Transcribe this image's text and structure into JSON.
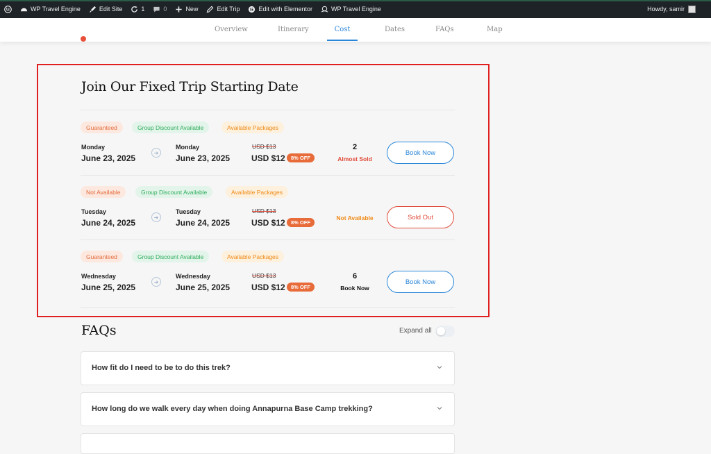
{
  "adminbar": {
    "site_name": "WP Travel Engine",
    "edit_site": "Edit Site",
    "updates_count": "1",
    "comments_count": "0",
    "new_label": "New",
    "edit_trip": "Edit Trip",
    "elementor": "Edit with Elementor",
    "plugin_label": "WP Travel Engine",
    "howdy": "Howdy, samir"
  },
  "tabs": [
    {
      "label": "Overview"
    },
    {
      "label": "Itinerary"
    },
    {
      "label": "Cost",
      "active": true
    },
    {
      "label": "Dates"
    },
    {
      "label": "FAQs"
    },
    {
      "label": "Map"
    }
  ],
  "dates_section": {
    "title": "Join Our Fixed Trip Starting Date",
    "departures": [
      {
        "badges": [
          "Guaranteed",
          "Group Discount Available",
          "Available Packages"
        ],
        "start_day": "Monday",
        "start_date": "June 23, 2025",
        "end_day": "Monday",
        "end_date": "June 23, 2025",
        "old_price": "USD $13",
        "price": "USD $12",
        "discount": "8% OFF",
        "seats": "2",
        "status": "Almost Sold",
        "button": "Book Now"
      },
      {
        "badges": [
          "Not Available",
          "Group Discount Available",
          "Available Packages"
        ],
        "start_day": "Tuesday",
        "start_date": "June 24, 2025",
        "end_day": "Tuesday",
        "end_date": "June 24, 2025",
        "old_price": "USD $13",
        "price": "USD $12",
        "discount": "8% OFF",
        "seats": "",
        "status": "Not Available",
        "button": "Sold Out"
      },
      {
        "badges": [
          "Guaranteed",
          "Group Discount Available",
          "Available Packages"
        ],
        "start_day": "Wednesday",
        "start_date": "June 25, 2025",
        "end_day": "Wednesday",
        "end_date": "June 25, 2025",
        "old_price": "USD $13",
        "price": "USD $12",
        "discount": "8% OFF",
        "seats": "6",
        "status": "Book Now",
        "button": "Book Now"
      }
    ]
  },
  "faqs": {
    "title": "FAQs",
    "expand_all": "Expand all",
    "expand_all_on": false,
    "items": [
      {
        "question": "How fit do I need to be to do this trek?"
      },
      {
        "question": "How long do we walk every day when doing Annapurna Base Camp trekking?"
      }
    ]
  },
  "colors": {
    "accent": "#2a86d8",
    "danger": "#e04b3a",
    "highlight_frame": "#e02020"
  }
}
